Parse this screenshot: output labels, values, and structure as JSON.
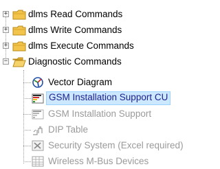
{
  "tree": {
    "folders": [
      {
        "label": "dlms Read Commands",
        "expanded": false
      },
      {
        "label": "dlms Write Commands",
        "expanded": false
      },
      {
        "label": "dlms Execute Commands",
        "expanded": false
      },
      {
        "label": "Diagnostic Commands",
        "expanded": true
      }
    ],
    "children": [
      {
        "label": "Vector Diagram",
        "icon": "vector-diagram-icon",
        "state": "enabled"
      },
      {
        "label": "GSM Installation Support CU",
        "icon": "signal-bars-icon",
        "state": "selected"
      },
      {
        "label": "GSM Installation Support",
        "icon": "signal-bars-icon",
        "state": "disabled"
      },
      {
        "label": "DIP Table",
        "icon": "dip-switch-icon",
        "state": "disabled"
      },
      {
        "label": "Security System (Excel required)",
        "icon": "excel-icon",
        "state": "disabled"
      },
      {
        "label": "Wireless M-Bus Devices",
        "icon": "table-grid-icon",
        "state": "disabled"
      }
    ],
    "colors": {
      "folder": "#e8b430",
      "selection": "#cce8ff",
      "disabled_text": "#9a9a9a"
    }
  }
}
